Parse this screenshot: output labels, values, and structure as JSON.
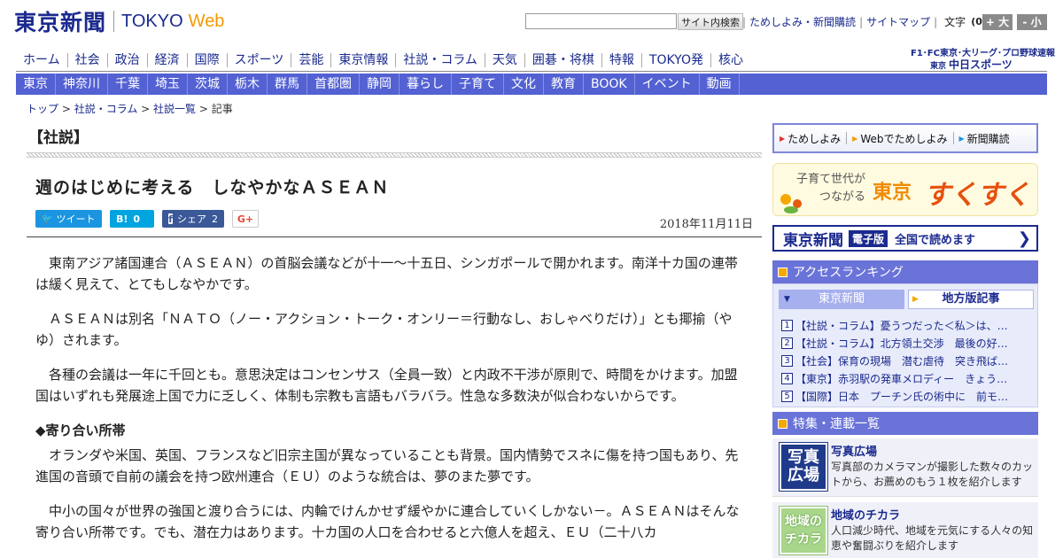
{
  "header": {
    "logo_jp": "東京新聞",
    "logo_en": "TOKYO",
    "logo_web": "Web",
    "search_placeholder": "",
    "search_button": "サイト内検索",
    "util_links": [
      "ためしよみ・新聞購読",
      "サイトマップ"
    ],
    "font_size_label": "文字",
    "font_size_value": "(0)",
    "font_larger": "+ 大",
    "font_smaller": "- 小"
  },
  "main_nav": [
    "ホーム",
    "社会",
    "政治",
    "経済",
    "国際",
    "スポーツ",
    "芸能",
    "東京情報",
    "社説・コラム",
    "天気",
    "囲碁・将棋",
    "特報",
    "TOKYO発",
    "核心"
  ],
  "sports_links": {
    "f1_line": "F1･FC東京･大リーグ･プロ野球速報",
    "chunichi_small": "東京",
    "chunichi": "中日スポーツ"
  },
  "region_nav": [
    "東京",
    "神奈川",
    "千葉",
    "埼玉",
    "茨城",
    "栃木",
    "群馬",
    "首都圏",
    "静岡",
    "暮らし",
    "子育て",
    "文化",
    "教育",
    "BOOK",
    "イベント",
    "動画"
  ],
  "breadcrumb": {
    "items": [
      "トップ",
      "社説・コラム",
      "社説一覧"
    ],
    "current": "記事",
    "sep": " > "
  },
  "article": {
    "section": "【社説】",
    "title": "週のはじめに考える　しなやかなＡＳＥＡＮ",
    "date": "2018年11月11日",
    "share": {
      "tweet": "ツイート",
      "hatena": "B!",
      "hatena_count": "0",
      "facebook": "シェア",
      "facebook_count": "2",
      "gplus": "G+"
    },
    "paragraphs": [
      "東南アジア諸国連合（ＡＳＥＡＮ）の首脳会議などが十一～十五日、シンガポールで開かれます。南洋十カ国の連帯は緩く見えて、とてもしなやかです。",
      "ＡＳＥＡＮは別名「ＮＡＴＯ（ノー・アクション・トーク・オンリー＝行動なし、おしゃべりだけ）」とも揶揄（やゆ）されます。",
      "各種の会議は一年に千回とも。意思決定はコンセンサス（全員一致）と内政不干渉が原則で、時間をかけます。加盟国はいずれも発展途上国で力に乏しく、体制も宗教も言語もバラバラ。性急な多数決が似合わないからです。"
    ],
    "subheading": "◆寄り合い所帯",
    "paragraphs2": [
      "オランダや米国、英国、フランスなど旧宗主国が異なっていることも背景。国内情勢でスネに傷を持つ国もあり、先進国の音頭で自前の議会を持つ欧州連合（ＥＵ）のような統合は、夢のまた夢です。",
      "中小の国々が世界の強国と渡り合うには、内輪でけんかせず緩やかに連合していくしかない－。ＡＳＥＡＮはそんな寄り合い所帯です。でも、潜在力はあります。十カ国の人口を合わせると六億人を超え、ＥＵ（二十八カ"
    ]
  },
  "sidebar": {
    "subscribe": [
      "ためしよみ",
      "Webでためしよみ",
      "新聞購読"
    ],
    "sukusuku": {
      "sub1": "子育て世代が",
      "sub2": "つながる",
      "title1": "東京",
      "title2": "すくすく"
    },
    "denshi": {
      "logo": "東京新聞",
      "badge": "電子版",
      "text": "全国で読めます"
    },
    "ranking": {
      "heading": "アクセスランキング",
      "tab_active": "東京新聞",
      "tab_other": "地方版記事",
      "items": [
        {
          "num": "1",
          "text": "【社説・コラム】憂うつだった＜私＞は、…"
        },
        {
          "num": "2",
          "text": "【社説・コラム】北方領土交渉　最後の好…"
        },
        {
          "num": "3",
          "text": "【社会】保育の現場　潜む虐待　突き飛ば…"
        },
        {
          "num": "4",
          "text": "【東京】赤羽駅の発車メロディー　きょう…"
        },
        {
          "num": "5",
          "text": "【国際】日本　プーチン氏の術中に　前モ…"
        }
      ]
    },
    "features": {
      "heading": "特集・連載一覧",
      "items": [
        {
          "img": "写真広場",
          "title": "写真広場",
          "desc": "写真部のカメラマンが撮影した数々のカットから、お薦めのもう１枚を紹介します"
        },
        {
          "img": "地域のチカラ",
          "title": "地域のチカラ",
          "desc": "人口減少時代、地域を元気にする人々の知恵や奮闘ぶりを紹介します"
        }
      ]
    }
  },
  "colors": {
    "brand": "#1b2a8f",
    "accent": "#f29a00",
    "region_nav": "#5361d3",
    "sidebar_head": "#6a73d8"
  }
}
